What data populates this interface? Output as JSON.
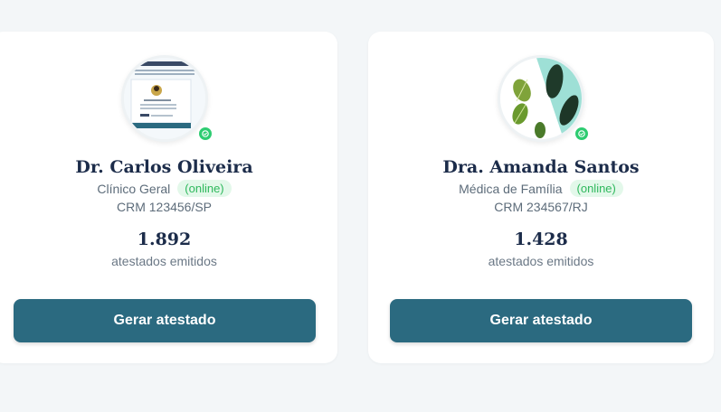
{
  "doctors": [
    {
      "name": "Dr. Carlos Oliveira",
      "specialty": "Clínico Geral",
      "status": "(online)",
      "crm": "CRM 123456/SP",
      "count": "1.892",
      "count_label": "atestados emitidos",
      "button_label": "Gerar atestado",
      "avatar_icon": "document-thumbnail-avatar"
    },
    {
      "name": "Dra. Amanda Santos",
      "specialty": "Médica de Família",
      "status": "(online)",
      "crm": "CRM 234567/RJ",
      "count": "1.428",
      "count_label": "atestados emitidos",
      "button_label": "Gerar atestado",
      "avatar_icon": "leaves-photo-avatar"
    }
  ],
  "colors": {
    "accent_button": "#2b6a80",
    "name_text": "#1c2c4a",
    "online_green": "#2ecc71",
    "online_pill_bg": "#e3f8ea"
  }
}
